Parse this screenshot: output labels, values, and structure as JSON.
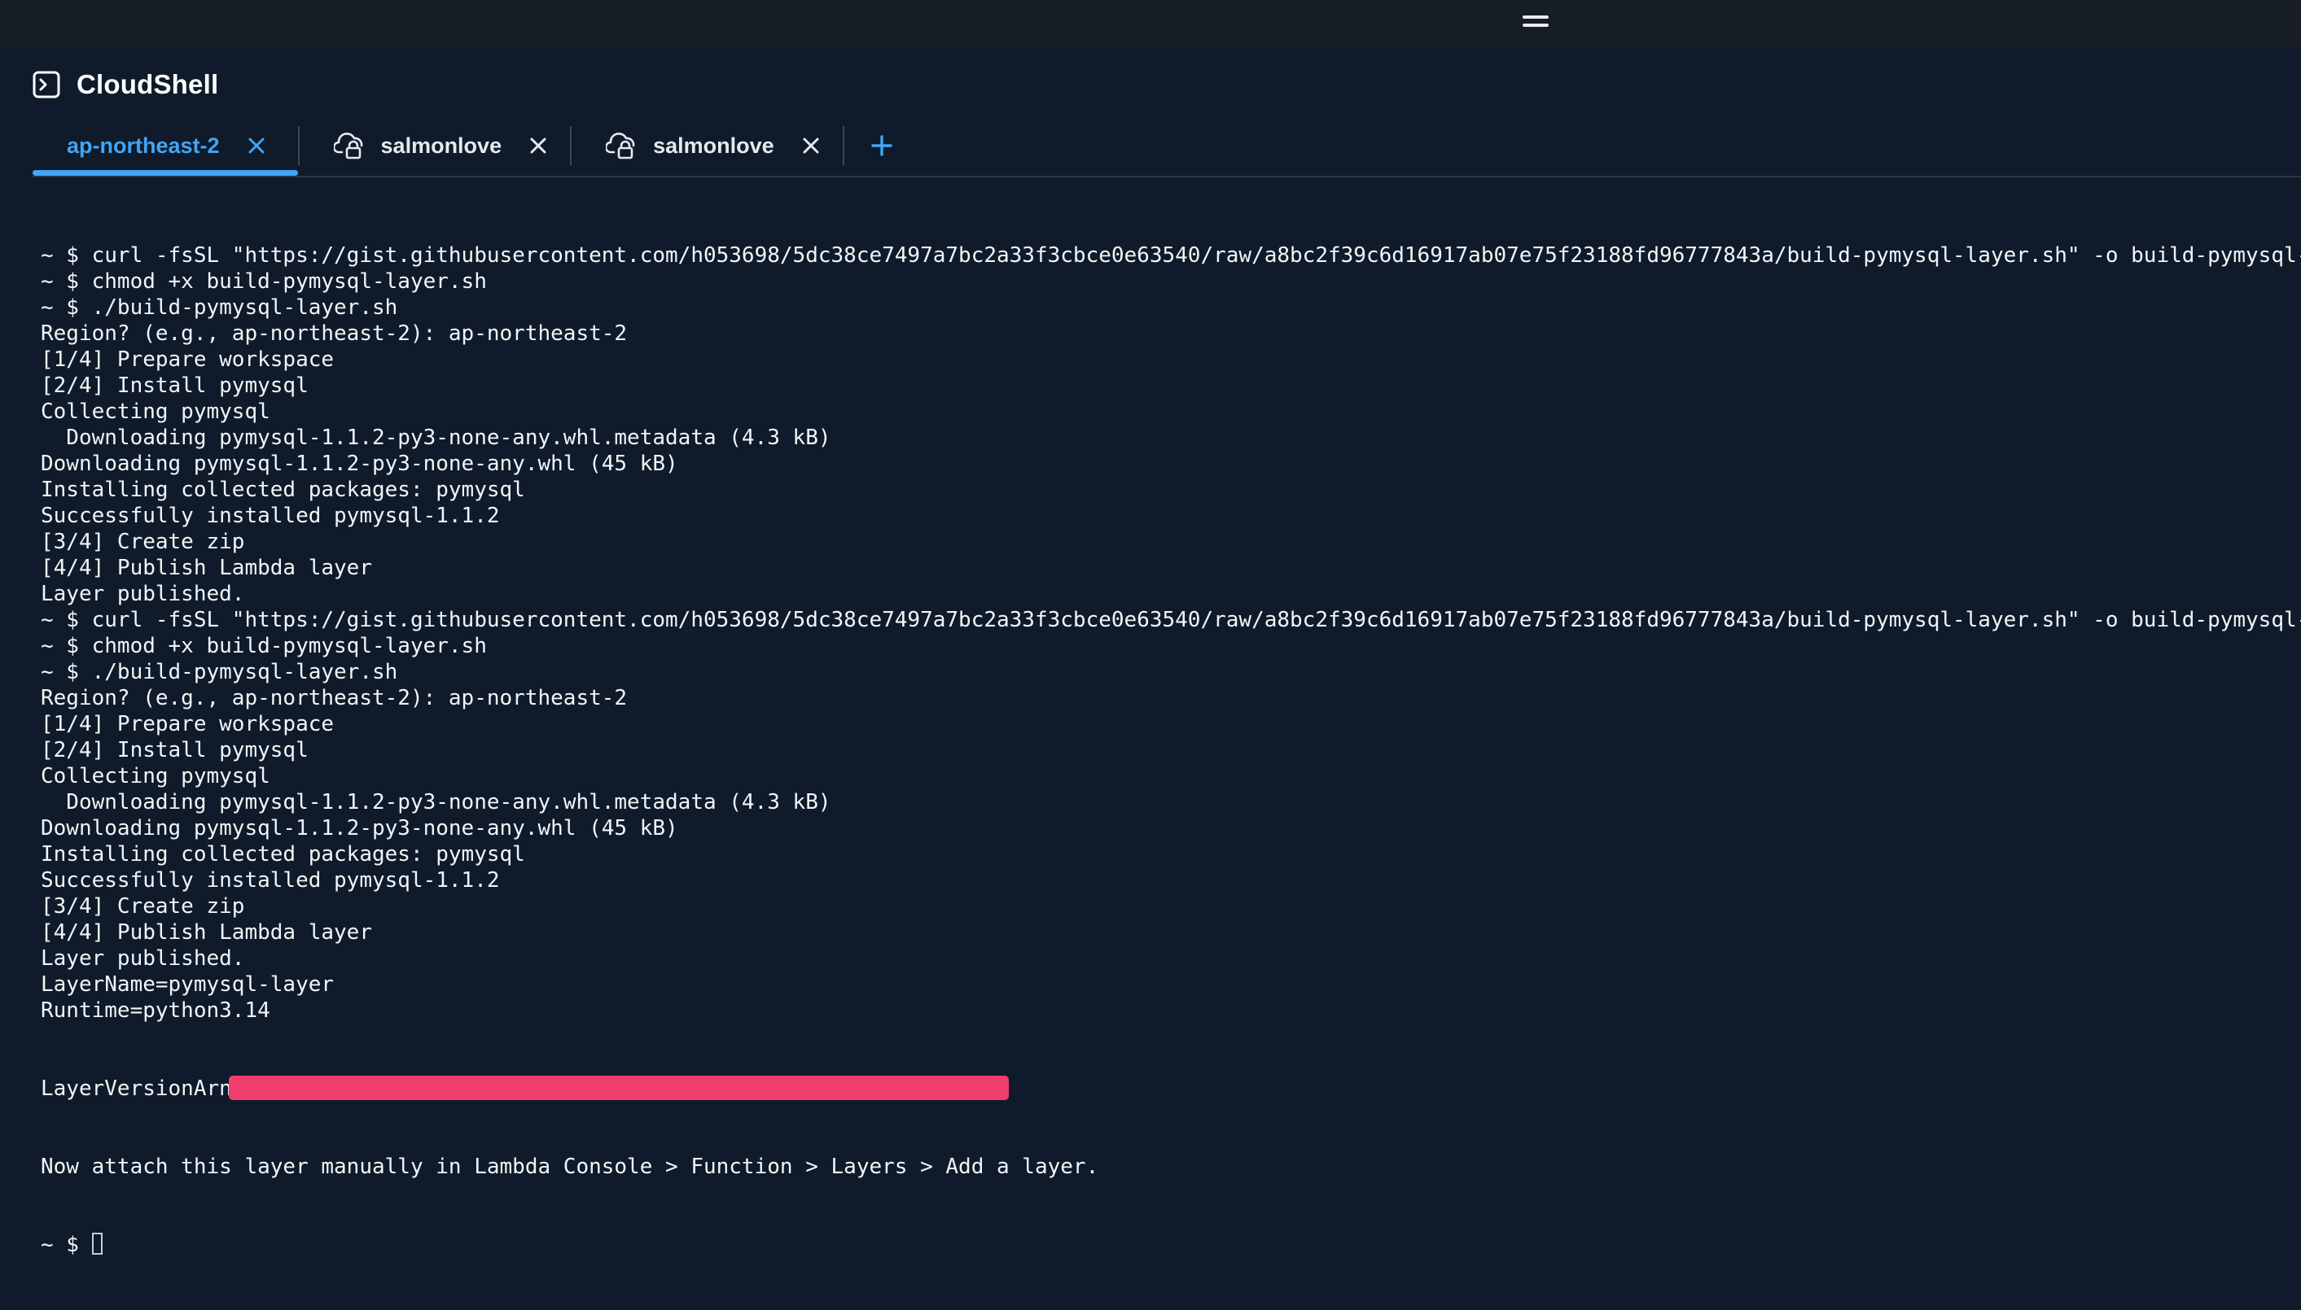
{
  "app": {
    "title": "CloudShell",
    "icon": "terminal-icon"
  },
  "tabs": [
    {
      "label": "ap-northeast-2",
      "active": true,
      "icon": ""
    },
    {
      "label": "salmonlove",
      "active": false,
      "icon": "cloud-lock-icon"
    },
    {
      "label": "salmonlove",
      "active": false,
      "icon": "cloud-lock-icon"
    }
  ],
  "colors": {
    "accent": "#42a5f5",
    "background": "#0f1b2a",
    "topbar": "#161d26",
    "redaction": "#ef3d6d",
    "text": "#f2f4f7"
  },
  "terminal": {
    "lines": [
      "~ $ curl -fsSL \"https://gist.githubusercontent.com/h053698/5dc38ce7497a7bc2a33f3cbce0e63540/raw/a8bc2f39c6d16917ab07e75f23188fd96777843a/build-pymysql-layer.sh\" -o build-pymysql-layer.sh",
      "~ $ chmod +x build-pymysql-layer.sh",
      "~ $ ./build-pymysql-layer.sh",
      "Region? (e.g., ap-northeast-2): ap-northeast-2",
      "[1/4] Prepare workspace",
      "[2/4] Install pymysql",
      "Collecting pymysql",
      "  Downloading pymysql-1.1.2-py3-none-any.whl.metadata (4.3 kB)",
      "Downloading pymysql-1.1.2-py3-none-any.whl (45 kB)",
      "Installing collected packages: pymysql",
      "Successfully installed pymysql-1.1.2",
      "[3/4] Create zip",
      "[4/4] Publish Lambda layer",
      "Layer published.",
      "~ $ curl -fsSL \"https://gist.githubusercontent.com/h053698/5dc38ce7497a7bc2a33f3cbce0e63540/raw/a8bc2f39c6d16917ab07e75f23188fd96777843a/build-pymysql-layer.sh\" -o build-pymysql-layer.sh",
      "~ $ chmod +x build-pymysql-layer.sh",
      "~ $ ./build-pymysql-layer.sh",
      "Region? (e.g., ap-northeast-2): ap-northeast-2",
      "[1/4] Prepare workspace",
      "[2/4] Install pymysql",
      "Collecting pymysql",
      "  Downloading pymysql-1.1.2-py3-none-any.whl.metadata (4.3 kB)",
      "Downloading pymysql-1.1.2-py3-none-any.whl (45 kB)",
      "Installing collected packages: pymysql",
      "Successfully installed pymysql-1.1.2",
      "[3/4] Create zip",
      "[4/4] Publish Lambda layer",
      "Layer published.",
      "LayerName=pymysql-layer",
      "Runtime=python3.14"
    ],
    "arn_line_prefix": "LayerVersionArn",
    "after_lines": [
      "Now attach this layer manually in Lambda Console > Function > Layers > Add a layer."
    ],
    "prompt": "~ $ "
  }
}
